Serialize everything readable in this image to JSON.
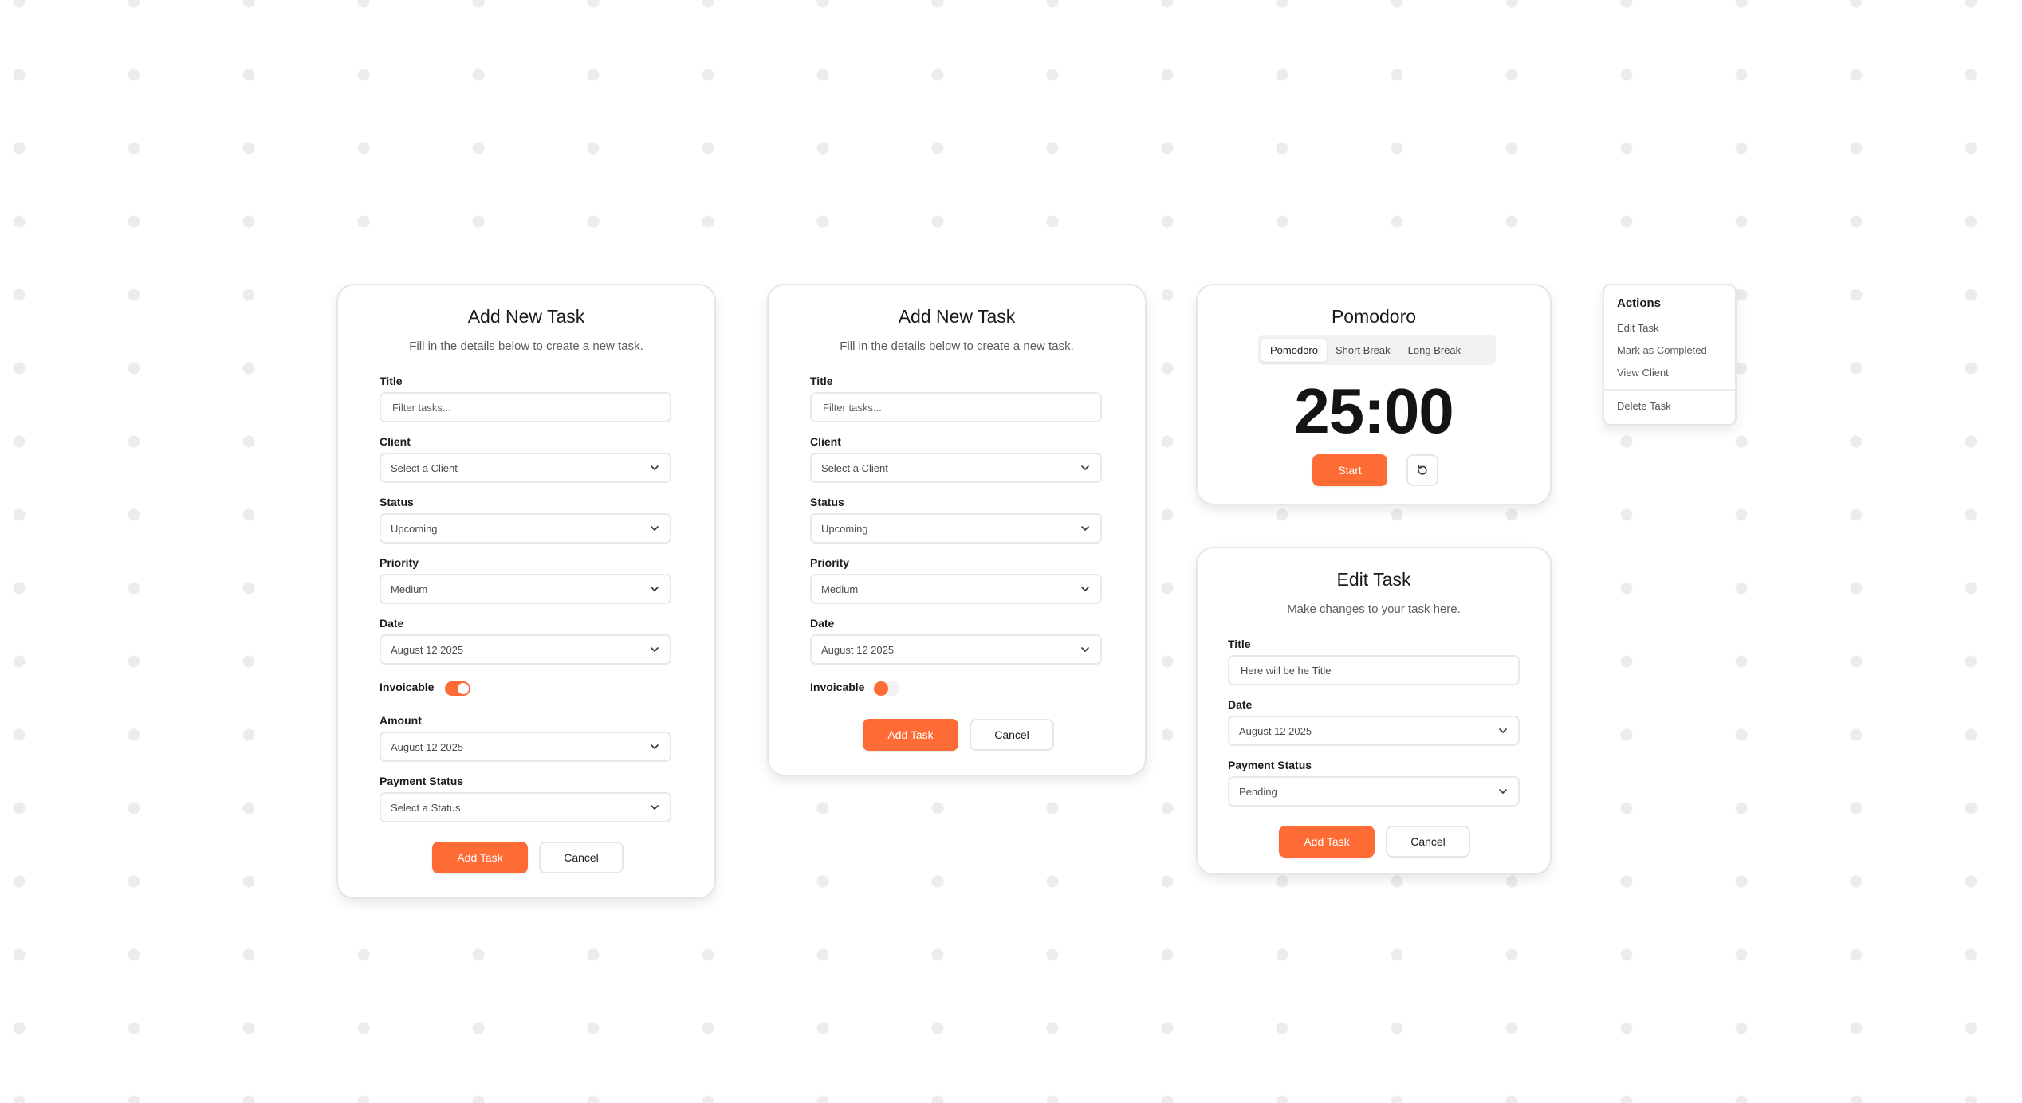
{
  "colors": {
    "accent": "#ff6b35",
    "border": "#e6e6e6",
    "text": "#1b1b1b",
    "muted": "#5c5c5c"
  },
  "add_task_full": {
    "title": "Add New Task",
    "subtitle": "Fill in the details below to create a new task.",
    "title_label": "Title",
    "title_placeholder": "Filter tasks...",
    "client_label": "Client",
    "client_value": "Select a Client",
    "status_label": "Status",
    "status_value": "Upcoming",
    "priority_label": "Priority",
    "priority_value": "Medium",
    "date_label": "Date",
    "date_value": "August 12 2025",
    "invoicable_label": "Invoicable",
    "invoicable_on": true,
    "amount_label": "Amount",
    "amount_value": "August 12 2025",
    "payment_label": "Payment Status",
    "payment_value": "Select a Status",
    "submit_label": "Add Task",
    "cancel_label": "Cancel"
  },
  "add_task_compact": {
    "title": "Add New Task",
    "subtitle": "Fill in the details below to create a new task.",
    "title_label": "Title",
    "title_placeholder": "Filter tasks...",
    "client_label": "Client",
    "client_value": "Select a Client",
    "status_label": "Status",
    "status_value": "Upcoming",
    "priority_label": "Priority",
    "priority_value": "Medium",
    "date_label": "Date",
    "date_value": "August 12 2025",
    "invoicable_label": "Invoicable",
    "invoicable_on": false,
    "submit_label": "Add Task",
    "cancel_label": "Cancel"
  },
  "pomodoro": {
    "title": "Pomodoro",
    "tabs": [
      {
        "label": "Pomodoro",
        "active": true
      },
      {
        "label": "Short Break",
        "active": false
      },
      {
        "label": "Long Break",
        "active": false
      }
    ],
    "time": "25:00",
    "start_label": "Start",
    "reset_icon": "reset-icon"
  },
  "edit_task": {
    "title": "Edit Task",
    "subtitle": "Make changes to your task here.",
    "title_label": "Title",
    "title_value": "Here will be he Title",
    "date_label": "Date",
    "date_value": "August 12 2025",
    "payment_label": "Payment Status",
    "payment_value": "Pending",
    "submit_label": "Add Task",
    "cancel_label": "Cancel"
  },
  "actions_menu": {
    "title": "Actions",
    "items": [
      "Edit Task",
      "Mark as Completed",
      "View Client"
    ],
    "danger_item": "Delete Task"
  }
}
